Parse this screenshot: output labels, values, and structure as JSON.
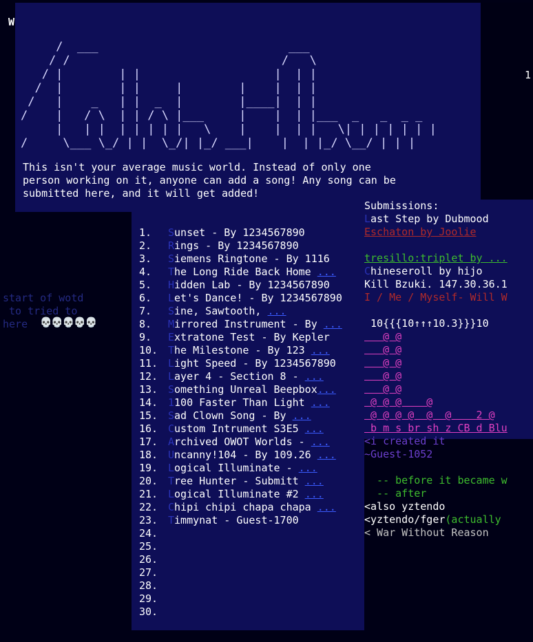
{
  "corner": {
    "left": "W",
    "right": "1"
  },
  "ascii_title": "     /  ___                           ___\n    / /                              /   \\\n   / |        | |                   |  | |\n  /  |        | |     |        |    |  | |\n /   |    _   | |  _  |        |____|  | |\n/    |   / \\  | | / \\ |___     |    |  | |___  _   _  _ _\n     |   | |  | | | | |   \\    |    |  | |   \\| | | | | | |\n/     \\___ \\_/ | |  \\_/| |_/ ___|    |  | |_/ \\__/ | | |",
  "intro": "This isn't your average music world. Instead of only one\nperson working on it, anyone can add a song! Any song can be\nsubmitted here, and it will get added!",
  "left_note": {
    "line1": "start of wotd",
    "line2": " to tried to",
    "line3": "here",
    "skulls": "💀💀💀💀💀"
  },
  "songs": [
    {
      "num": "1.",
      "first": "S",
      "rest": "unset - By 1234567890",
      "tail": ""
    },
    {
      "num": "2.",
      "first": "R",
      "rest": "ings - By 1234567890",
      "tail": ""
    },
    {
      "num": "3.",
      "first": "S",
      "rest": "iemens Ringtone - By 1116",
      "tail": ""
    },
    {
      "num": "4.",
      "first": "T",
      "rest": "he Long Ride Back Home ",
      "tail": "..."
    },
    {
      "num": "5.",
      "first": "H",
      "rest": "idden Lab - By 1234567890",
      "tail": ""
    },
    {
      "num": "6.",
      "first": "L",
      "rest": "et's Dance! - By 1234567890",
      "tail": ""
    },
    {
      "num": "7.",
      "first": "S",
      "rest": "ine, Sawtooth, ",
      "tail": "..."
    },
    {
      "num": "8.",
      "first": "M",
      "rest": "irrored Instrument - By ",
      "tail": "..."
    },
    {
      "num": "9.",
      "first": "E",
      "rest": "xtratone Test - By Kepler",
      "tail": ""
    },
    {
      "num": "10.",
      "first": "T",
      "rest": "he Milestone - By 123 ",
      "tail": "..."
    },
    {
      "num": "11.",
      "first": "L",
      "rest": "ight Speed - By 1234567890",
      "tail": ""
    },
    {
      "num": "12.",
      "first": "L",
      "rest": "ayer 4 - Section 8 - ",
      "tail": "..."
    },
    {
      "num": "13.",
      "first": "S",
      "rest": "omething Unreal Beepbox",
      "tail": "..."
    },
    {
      "num": "14.",
      "first": "1",
      "rest": "100 Faster Than Light ",
      "tail": "..."
    },
    {
      "num": "15.",
      "first": "S",
      "rest": "ad Clown Song - By ",
      "tail": "..."
    },
    {
      "num": "16.",
      "first": "C",
      "rest": "ustom Intrument S3E5 ",
      "tail": "..."
    },
    {
      "num": "17.",
      "first": "A",
      "rest": "rchived OWOT Worlds - ",
      "tail": "..."
    },
    {
      "num": "18.",
      "first": "U",
      "rest": "ncanny!104 - By 109.26 ",
      "tail": "..."
    },
    {
      "num": "19.",
      "first": "L",
      "rest": "ogical Illuminate - ",
      "tail": "..."
    },
    {
      "num": "20.",
      "first": "T",
      "rest": "ree Hunter - Submitt ",
      "tail": "..."
    },
    {
      "num": "21.",
      "first": "L",
      "rest": "ogical Illuminate #2 ",
      "tail": "..."
    },
    {
      "num": "22.",
      "first": "C",
      "rest": "hipi chipi chapa chapa ",
      "tail": "..."
    },
    {
      "num": "23.",
      "first": "T",
      "rest": "immynat - Guest-1700",
      "tail": ""
    },
    {
      "num": "24.",
      "first": "",
      "rest": "",
      "tail": ""
    },
    {
      "num": "25.",
      "first": "",
      "rest": "",
      "tail": ""
    },
    {
      "num": "26.",
      "first": "",
      "rest": "",
      "tail": ""
    },
    {
      "num": "27.",
      "first": "",
      "rest": "",
      "tail": ""
    },
    {
      "num": "28.",
      "first": "",
      "rest": "",
      "tail": ""
    },
    {
      "num": "29.",
      "first": "",
      "rest": "",
      "tail": ""
    },
    {
      "num": "30.",
      "first": "",
      "rest": "",
      "tail": ""
    }
  ],
  "submissions": {
    "heading": "Submissions:",
    "rows": [
      [
        {
          "t": "L",
          "c": "c-blue"
        },
        {
          "t": "ast Step by Dubmood",
          "c": "c-white"
        }
      ],
      [
        {
          "t": "Eschaton by Joolie",
          "c": "c-red ul"
        }
      ],
      [
        {
          "t": "",
          "c": "c-white"
        }
      ],
      [
        {
          "t": "tresillo:triplet by ",
          "c": "c-green ul"
        },
        {
          "t": "...",
          "c": "c-green ul"
        }
      ],
      [
        {
          "t": "C",
          "c": "c-blue"
        },
        {
          "t": "hineseroll by hijo",
          "c": "c-white"
        }
      ],
      [
        {
          "t": "Kill Bzuki. 147.30.36.1",
          "c": "c-white"
        }
      ],
      [
        {
          "t": "I / Me / Myself- Will W",
          "c": "c-red"
        }
      ],
      [
        {
          "t": "",
          "c": "c-white"
        }
      ],
      [
        {
          "t": " 10{{{10↑↑↑10.3}}}10",
          "c": "c-white"
        }
      ],
      [
        {
          "t": "   @ @",
          "c": "c-magenta ul"
        }
      ],
      [
        {
          "t": "   @ @",
          "c": "c-magenta ul"
        }
      ],
      [
        {
          "t": "   @ @",
          "c": "c-magenta ul"
        }
      ],
      [
        {
          "t": "   @ @",
          "c": "c-magenta ul"
        }
      ],
      [
        {
          "t": "   @ @",
          "c": "c-magenta ul"
        }
      ],
      [
        {
          "t": " @ @ @    @",
          "c": "c-magenta ul"
        }
      ],
      [
        {
          "t": " @ @ @ @  @  @    2 @",
          "c": "c-magenta ul"
        }
      ],
      [
        {
          "t": " b m s br sh z CB d Blu",
          "c": "c-magenta ul"
        }
      ],
      [
        {
          "t": "<i created it",
          "c": "c-purple"
        }
      ],
      [
        {
          "t": "~Guest-1052",
          "c": "c-purple"
        }
      ],
      [
        {
          "t": "",
          "c": "c-white"
        }
      ],
      [
        {
          "t": "  -- before it became w",
          "c": "c-green"
        }
      ],
      [
        {
          "t": "  -- after",
          "c": "c-green"
        }
      ],
      [
        {
          "t": "<also yztendo",
          "c": "c-white"
        }
      ],
      [
        {
          "t": "<yztendo/fger",
          "c": "c-white"
        },
        {
          "t": "(actually ",
          "c": "c-green"
        }
      ],
      [
        {
          "t": "< War Without Reason",
          "c": "c-gray"
        }
      ]
    ]
  }
}
